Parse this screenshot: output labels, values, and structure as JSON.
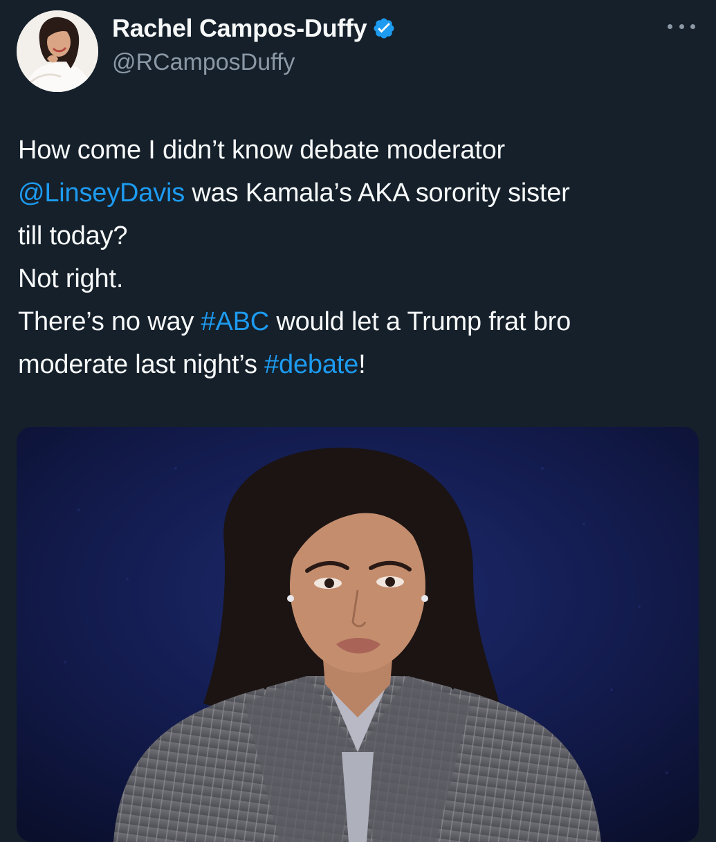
{
  "author": {
    "display_name": "Rachel Campos-Duffy",
    "handle": "@RCamposDuffy",
    "verified": true,
    "avatar_icon": "profile-photo"
  },
  "menu": {
    "icon": "more-horizontal-icon"
  },
  "tweet": {
    "segments_line1": {
      "text": "How come I didn’t know debate moderator"
    },
    "segments_line2": {
      "mention": "@LinseyDavis",
      "rest": " was Kamala’s AKA sorority sister"
    },
    "segments_line3": {
      "text": "till today?"
    },
    "segments_line4": {
      "text": "Not right."
    },
    "segments_line5": {
      "pre": "There’s no way ",
      "hashtag": "#ABC",
      "post": " would let a Trump frat bro"
    },
    "segments_line6": {
      "pre": "moderate last night’s ",
      "hashtag": "#debate",
      "post": "!"
    }
  },
  "media": {
    "kind": "photo",
    "subject": "woman-in-pinstripe-blazer-on-blue-stage"
  },
  "colors": {
    "background": "#15202b",
    "text": "#f7f9f9",
    "secondary": "#8b98a5",
    "link": "#1d9bf0",
    "verified_badge": "#1d9bf0"
  }
}
